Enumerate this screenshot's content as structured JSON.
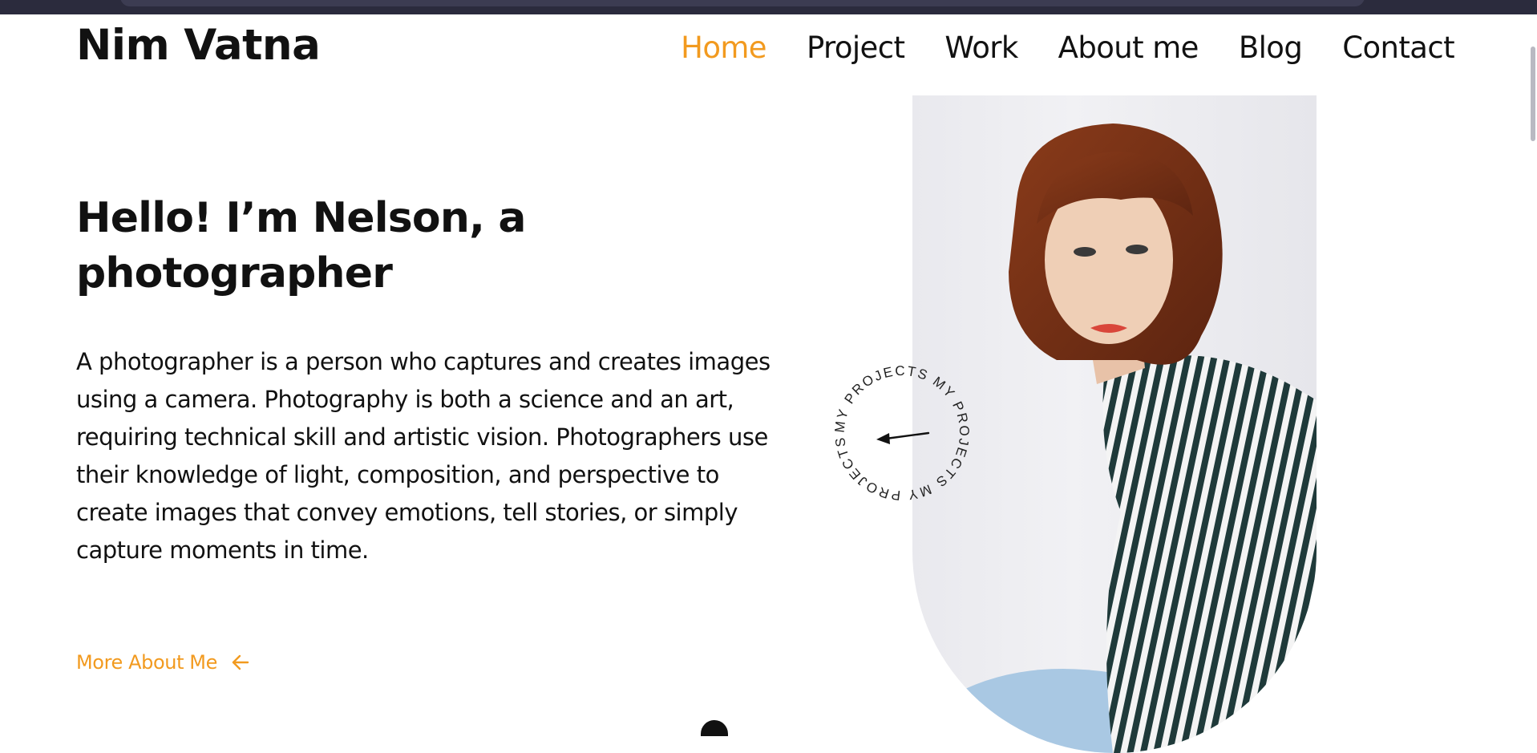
{
  "brand": {
    "name": "Nim Vatna"
  },
  "nav": {
    "items": [
      {
        "label": "Home",
        "active": true
      },
      {
        "label": "Project",
        "active": false
      },
      {
        "label": "Work",
        "active": false
      },
      {
        "label": "About me",
        "active": false
      },
      {
        "label": "Blog",
        "active": false
      },
      {
        "label": "Contact",
        "active": false
      }
    ]
  },
  "hero": {
    "title_line1": "Hello! I’m Nelson, a",
    "title_line2": "photographer",
    "description": "A photographer is a person who captures and creates images using a camera. Photography is both a science and an art, requiring technical skill and artistic vision. Photographers use their knowledge of light, composition, and perspective to create images that convey emotions, tell stories, or simply capture moments in time.",
    "cta_label": "More About Me",
    "cta_icon": "arrow-left-icon"
  },
  "badge": {
    "text": "MY PROJECTS   MY PROJECTS   MY PROJECTS",
    "icon": "arrow-left-icon"
  },
  "colors": {
    "accent": "#f29a1f",
    "text": "#111111",
    "background": "#ffffff"
  }
}
